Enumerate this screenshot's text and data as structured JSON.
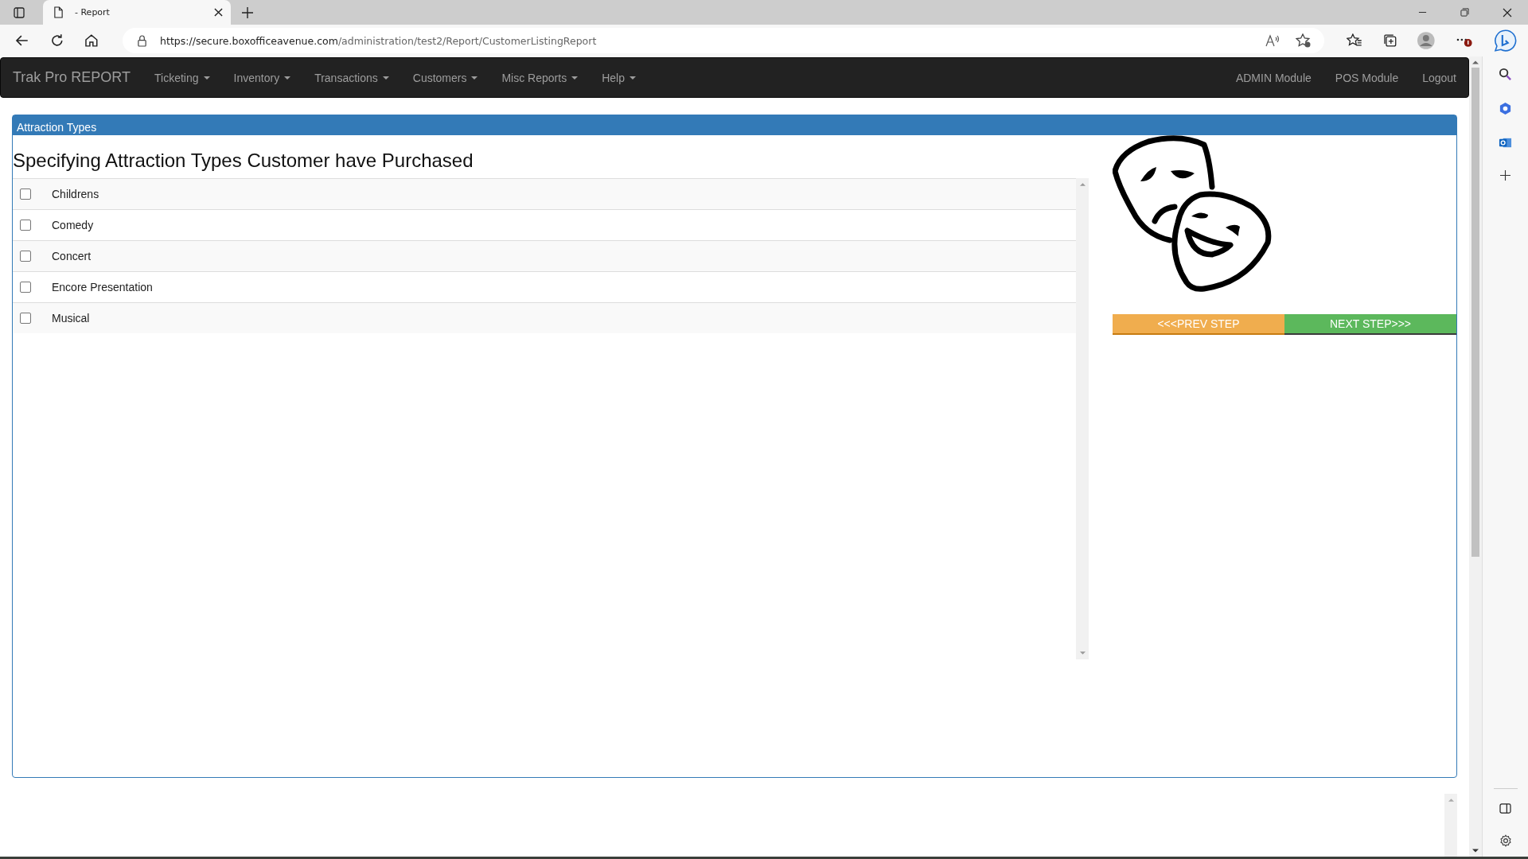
{
  "browser": {
    "tab_title": "- Report",
    "url_host": "https://secure.boxofficeavenue.com",
    "url_path": "/administration/test2/Report/CustomerListingReport"
  },
  "navbar": {
    "brand": "Trak Pro REPORT",
    "menus": [
      {
        "label": "Ticketing"
      },
      {
        "label": "Inventory"
      },
      {
        "label": "Transactions"
      },
      {
        "label": "Customers"
      },
      {
        "label": "Misc Reports"
      },
      {
        "label": "Help"
      }
    ],
    "links": [
      "ADMIN Module",
      "POS Module",
      "Logout"
    ]
  },
  "panel": {
    "title": "Attraction Types",
    "heading": "Specifying Attraction Types Customer have Purchased",
    "items": [
      {
        "label": "Childrens",
        "checked": false
      },
      {
        "label": "Comedy",
        "checked": false
      },
      {
        "label": "Concert",
        "checked": false
      },
      {
        "label": "Encore Presentation",
        "checked": false
      },
      {
        "label": "Musical",
        "checked": false
      }
    ],
    "buttons": [
      {
        "label": "<<<PREV STEP",
        "kind": "prev"
      },
      {
        "label": "NEXT STEP>>>",
        "kind": "next"
      }
    ]
  }
}
